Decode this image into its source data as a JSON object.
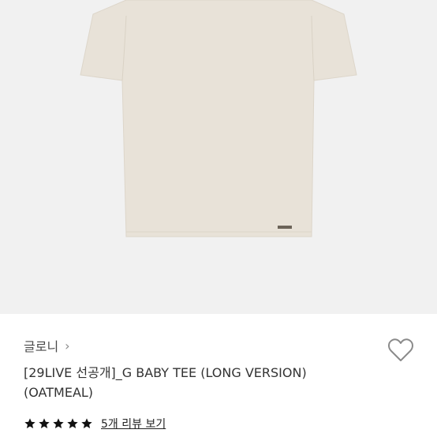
{
  "product": {
    "brand": "글로니",
    "title_line1": "[29LIVE 선공개]_G BABY TEE (LONG VERSION)",
    "title_line2": "(OATMEAL)",
    "rating_stars": 5,
    "review_link": "5개 리뷰 보기",
    "image_color": "#e8e2d8",
    "background_color": "#f1f1f1"
  },
  "icons": {
    "brand_arrow": "chevron-right-icon",
    "wishlist": "heart-outline-icon",
    "star": "star-filled-icon"
  }
}
